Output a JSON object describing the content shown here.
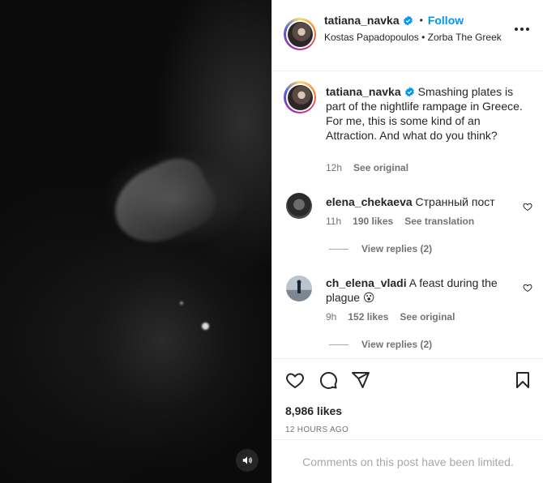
{
  "media": {
    "type": "video",
    "sound_icon": "speaker-icon"
  },
  "header": {
    "username": "tatiana_navka",
    "dot": "•",
    "follow_label": "Follow",
    "audio": "Kostas Papadopoulos • Zorba The Greek",
    "more_icon": "more-horizontal-icon"
  },
  "caption": {
    "username": "tatiana_navka",
    "text": "Smashing plates is part of the nightlife rampage in Greece. For me, this is some kind of an Attraction. And what do you think?",
    "time": "12h",
    "see_original": "See original"
  },
  "comments": [
    {
      "username": "elena_chekaeva",
      "text": "Странный пост",
      "time": "11h",
      "likes": "190 likes",
      "action": "See translation",
      "view_replies": "View replies (2)"
    },
    {
      "username": "ch_elena_vladi",
      "text": "A feast during the plague 😮",
      "time": "9h",
      "likes": "152 likes",
      "action": "See original",
      "view_replies": "View replies (2)"
    }
  ],
  "actions": {
    "icons": [
      "heart-icon",
      "comment-icon",
      "share-icon",
      "bookmark-icon"
    ],
    "likes": "8,986 likes",
    "time_ago": "12 HOURS AGO"
  },
  "footer": {
    "limited_text": "Comments on this post have been limited."
  },
  "colors": {
    "accent": "#0095f6",
    "verified": "#0095f6",
    "muted": "#737373"
  }
}
